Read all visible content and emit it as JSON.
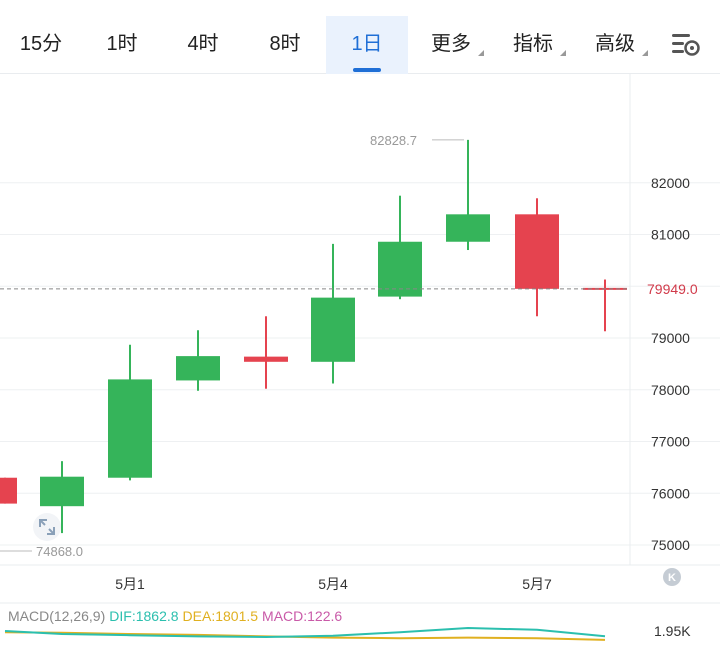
{
  "tabs": [
    {
      "label": "15分",
      "active": false,
      "dropdown": false
    },
    {
      "label": "1时",
      "active": false,
      "dropdown": false
    },
    {
      "label": "4时",
      "active": false,
      "dropdown": false
    },
    {
      "label": "8时",
      "active": false,
      "dropdown": false
    },
    {
      "label": "1日",
      "active": true,
      "dropdown": false
    },
    {
      "label": "更多",
      "active": false,
      "dropdown": true
    },
    {
      "label": "指标",
      "active": false,
      "dropdown": true
    },
    {
      "label": "高级",
      "active": false,
      "dropdown": true
    }
  ],
  "settings_icon": "chart-settings-icon",
  "colors": {
    "up": "#35b45a",
    "down": "#e5434f",
    "accent": "#1f6fd6",
    "dif": "#2bbfae",
    "dea": "#e0b020",
    "macd": "#c95aa8"
  },
  "chart_data": {
    "type": "candlestick",
    "price_axis": {
      "ticks": [
        75000,
        76000,
        77000,
        78000,
        79000,
        80000,
        81000,
        82000
      ],
      "tick_labels": [
        "75000",
        "76000",
        "77000",
        "78000",
        "79000",
        "",
        "81000",
        "82000"
      ]
    },
    "date_labels": [
      "5月1",
      "5月4",
      "5月7"
    ],
    "candles": [
      {
        "open": 75800,
        "close": 76300,
        "high": 76300,
        "low": 75800,
        "dir": "down",
        "partial": true
      },
      {
        "open": 75750,
        "close": 76320,
        "high": 76620,
        "low": 75230,
        "dir": "up"
      },
      {
        "open": 76300,
        "close": 78200,
        "high": 78870,
        "low": 76250,
        "dir": "up"
      },
      {
        "open": 78180,
        "close": 78650,
        "high": 79150,
        "low": 77980,
        "dir": "up"
      },
      {
        "open": 78640,
        "close": 78540,
        "high": 79420,
        "low": 78020,
        "dir": "down"
      },
      {
        "open": 78540,
        "close": 79780,
        "high": 80820,
        "low": 78120,
        "dir": "up"
      },
      {
        "open": 79800,
        "close": 80860,
        "high": 81750,
        "low": 79750,
        "dir": "up"
      },
      {
        "open": 80860,
        "close": 81390,
        "high": 82828.7,
        "low": 80700,
        "dir": "up"
      },
      {
        "open": 81390,
        "close": 79950,
        "high": 81700,
        "low": 79420,
        "dir": "down"
      },
      {
        "open": 79949,
        "close": 79940,
        "high": 80130,
        "low": 79130,
        "dir": "down",
        "partial": true
      }
    ],
    "max_label": "82828.7",
    "min_label": "74868.0",
    "last_price": 79949.0,
    "last_price_label": "79949.0",
    "macd": {
      "title": "MACD(12,26,9)",
      "dif_label": "DIF:1862.8",
      "dea_label": "DEA:1801.5",
      "macd_label": "MACD:122.6",
      "axis_label": "1.95K",
      "dif": [
        1950,
        1900,
        1880,
        1860,
        1850,
        1870,
        1930,
        2000,
        1970,
        1862.8
      ],
      "dea": [
        1930,
        1920,
        1900,
        1885,
        1860,
        1840,
        1830,
        1840,
        1830,
        1801.5
      ]
    }
  },
  "zoom_icon": "expand-arrows-icon",
  "reset_icon": "k-circle-icon"
}
